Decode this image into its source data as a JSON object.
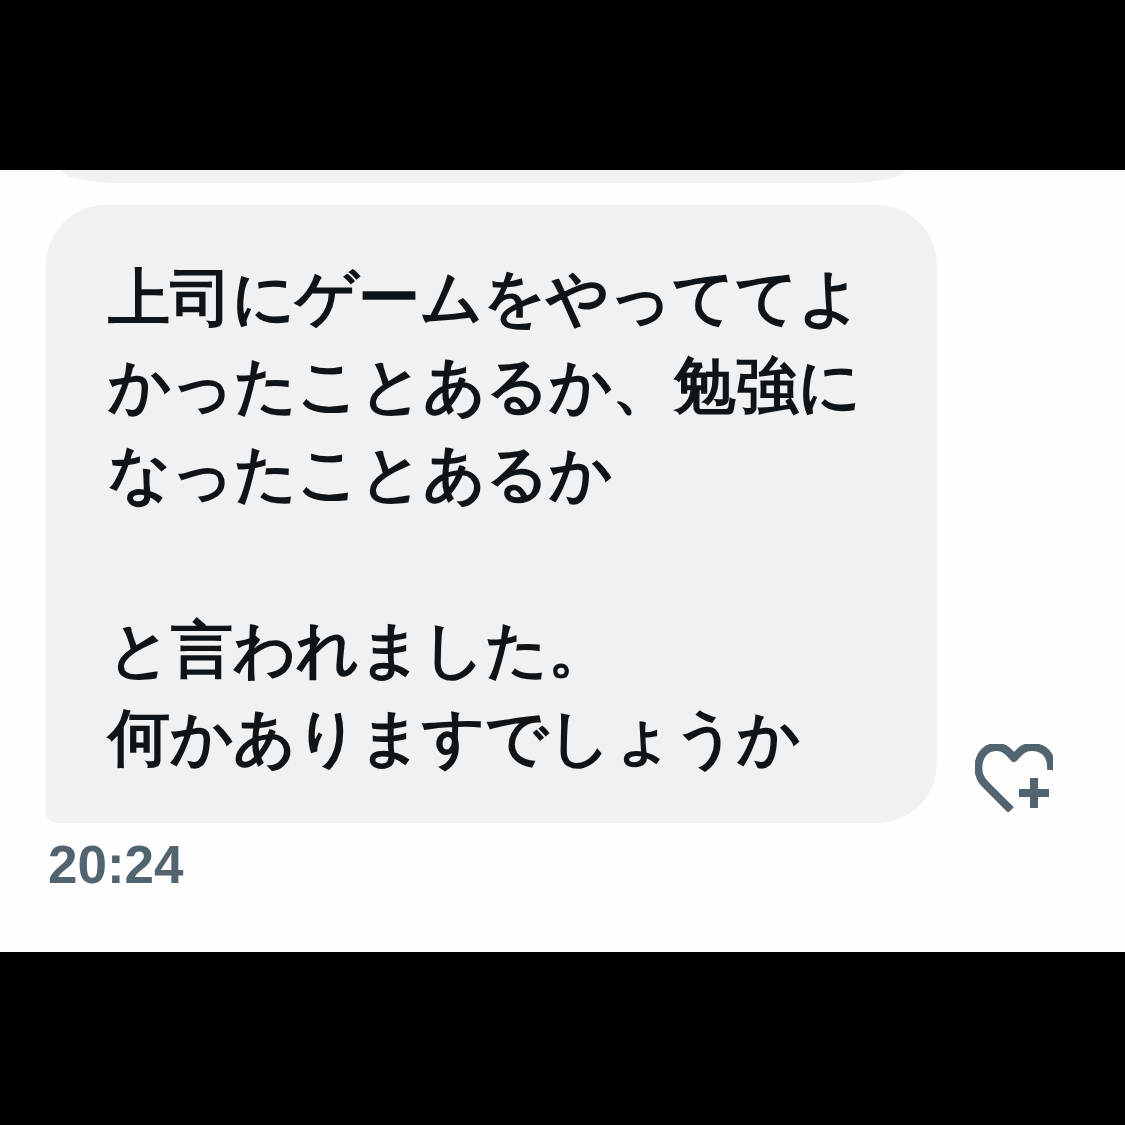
{
  "message": {
    "paragraphs": [
      [
        "上司にゲームをやっててよかったことあるか、勉強になったことあるか"
      ],
      [
        "と言われました。",
        "何かありますでしょうか"
      ]
    ],
    "time": "20:24"
  }
}
